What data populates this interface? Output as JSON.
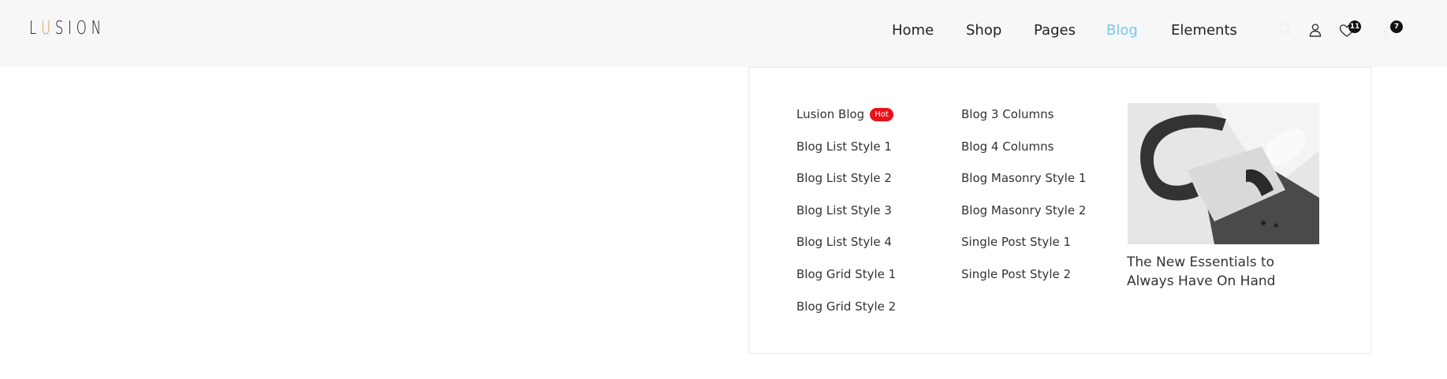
{
  "logo": {
    "text_first": "L",
    "text_accent": "U",
    "text_rest": "SION"
  },
  "nav": {
    "items": [
      {
        "label": "Home"
      },
      {
        "label": "Shop"
      },
      {
        "label": "Pages"
      },
      {
        "label": "Blog"
      },
      {
        "label": "Elements"
      }
    ],
    "active_item": "Blog"
  },
  "header_icons": {
    "search": "search-icon",
    "account": "user-icon",
    "wishlist": "heart-icon",
    "wishlist_count": "11",
    "cart": "cart-icon",
    "cart_count": "7"
  },
  "blog_menu": {
    "column1": [
      {
        "label": "Lusion Blog",
        "badge": "Hot"
      },
      {
        "label": "Blog List Style 1"
      },
      {
        "label": "Blog List Style 2"
      },
      {
        "label": "Blog List Style 3"
      },
      {
        "label": "Blog List Style 4"
      },
      {
        "label": "Blog Grid Style 1"
      },
      {
        "label": "Blog Grid Style 2"
      }
    ],
    "column2": [
      {
        "label": "Blog 3 Columns"
      },
      {
        "label": "Blog 4 Columns"
      },
      {
        "label": "Blog Masonry Style 1"
      },
      {
        "label": "Blog Masonry Style 2"
      },
      {
        "label": "Single Post Style 1"
      },
      {
        "label": "Single Post Style 2"
      }
    ],
    "featured": {
      "title": "The New Essentials to Always Have On Hand"
    }
  },
  "colors": {
    "accent": "#79c7ec",
    "logo_accent": "#c99a4a",
    "hot_badge": "#e8121a",
    "header_bg": "#f7f7f7"
  }
}
